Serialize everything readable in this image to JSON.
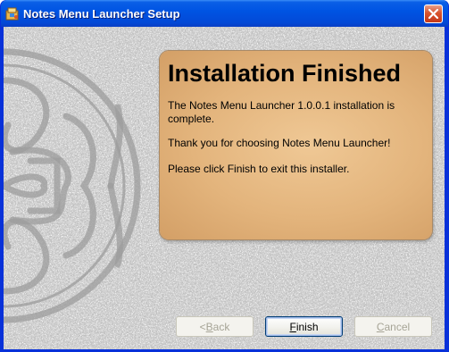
{
  "window": {
    "title": "Notes Menu Launcher Setup"
  },
  "panel": {
    "heading": "Installation Finished",
    "line1": "The Notes Menu Launcher 1.0.0.1 installation is complete.",
    "line2": "Thank you for choosing Notes Menu Launcher!",
    "line3": "Please click Finish to exit this installer."
  },
  "buttons": {
    "back": {
      "prefix": "< ",
      "mnemonic": "B",
      "rest": "ack",
      "enabled": false
    },
    "finish": {
      "prefix": "",
      "mnemonic": "F",
      "rest": "inish",
      "enabled": true
    },
    "cancel": {
      "prefix": "",
      "mnemonic": "C",
      "rest": "ancel",
      "enabled": false
    }
  },
  "colors": {
    "titlebar": "#0054e3",
    "panel": "#e3b47c",
    "background_stone": "#c7c7c7",
    "close_button": "#d9532c"
  },
  "icons": {
    "app": "installer-icon",
    "close": "close-icon",
    "decoration": "celtic-knot-icon"
  }
}
